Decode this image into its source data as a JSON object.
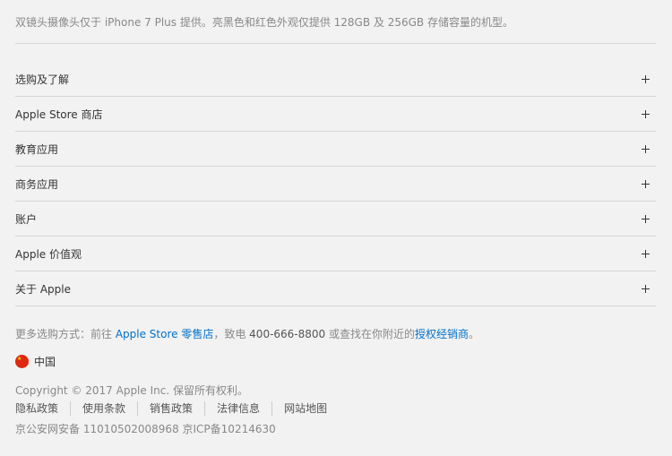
{
  "footnote": {
    "text": "双镜头摄像头仅于 iPhone 7 Plus 提供。亮黑色和红色外观仅提供 128GB 及 256GB 存储容量的机型。"
  },
  "accordion": {
    "items": [
      {
        "label": "选购及了解"
      },
      {
        "label": "Apple Store 商店"
      },
      {
        "label": "教育应用"
      },
      {
        "label": "商务应用"
      },
      {
        "label": "账户"
      },
      {
        "label": "Apple 价值观"
      },
      {
        "label": "关于 Apple"
      }
    ]
  },
  "shop": {
    "prefix": "更多选购方式：前往 ",
    "store_link": "Apple Store 零售店",
    "middle": "，致电 ",
    "phone": "400-666-8800",
    "suffix_pre": " 或查找在你附近的",
    "reseller_link": "授权经销商",
    "suffix_end": "。"
  },
  "locale": {
    "label": "中国",
    "flag_icon": "china-flag-icon"
  },
  "copyright": {
    "text": "Copyright © 2017 Apple Inc. 保留所有权利。"
  },
  "legal_links": [
    {
      "label": "隐私政策"
    },
    {
      "label": "使用条款"
    },
    {
      "label": "销售政策"
    },
    {
      "label": "法律信息"
    },
    {
      "label": "网站地图"
    }
  ],
  "icp": {
    "text": "京公安网安备 11010502008968 京ICP备10214630"
  },
  "colors": {
    "background": "#f2f2f2",
    "link": "#0070c9",
    "divider": "#d6d6d6"
  }
}
